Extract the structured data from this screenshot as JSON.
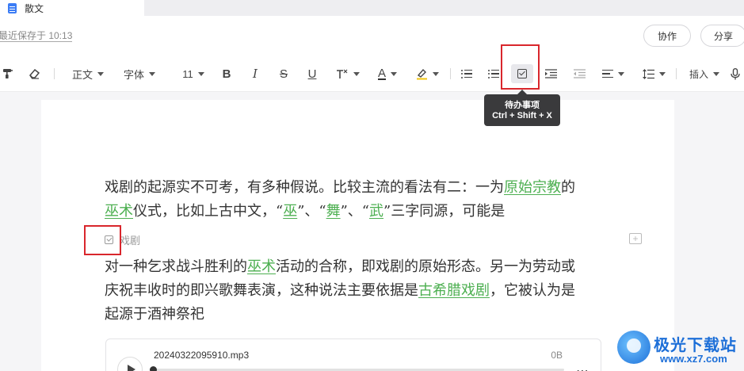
{
  "tab": {
    "title": "散文"
  },
  "header": {
    "save_status": "最近保存于 10:13",
    "collab_label": "协作",
    "share_label": "分享"
  },
  "toolbar": {
    "paragraph_style": "正文",
    "font_family": "字体",
    "font_size": "11",
    "bold": "B",
    "italic": "I",
    "strike": "S",
    "underline": "U",
    "font_color_glyph": "A",
    "insert_label": "插入"
  },
  "tooltip": {
    "title": "待办事项",
    "shortcut": "Ctrl + Shift + X"
  },
  "document": {
    "para1_line1": {
      "t1": "戏剧的起源实不可考，有多种假说。比较主流的看法有二：一为",
      "link1": "原始宗教",
      "t2": "的"
    },
    "para1_line2": {
      "link1": "巫术",
      "t1": "仪式，比如上古中文，“",
      "link2": "巫",
      "t2": "”、“",
      "link3": "舞",
      "t3": "”、“",
      "link4": "武",
      "t4": "”三字同源，可能是"
    },
    "todo_text": "戏剧",
    "para2_line1": {
      "t1": "对一种乞求战斗胜利的",
      "link1": "巫术",
      "t2": "活动的合称，即戏剧的原始形态。另一为劳动或"
    },
    "para2_line2": {
      "t1": "庆祝丰收时的即兴歌舞表演，这种说法主要依据是",
      "link1": "古希腊戏剧",
      "t2": "，它被认为是"
    },
    "para2_line3": "起源于酒神祭祀"
  },
  "audio": {
    "filename": "20240322095910.mp3",
    "size": "0B",
    "progress": 0
  },
  "watermark": {
    "title": "极光下载站",
    "url": "www.xz7.com"
  },
  "colors": {
    "link": "#4caf50",
    "highlight_box": "#d9262c",
    "tooltip_bg": "#3a3a3c"
  }
}
